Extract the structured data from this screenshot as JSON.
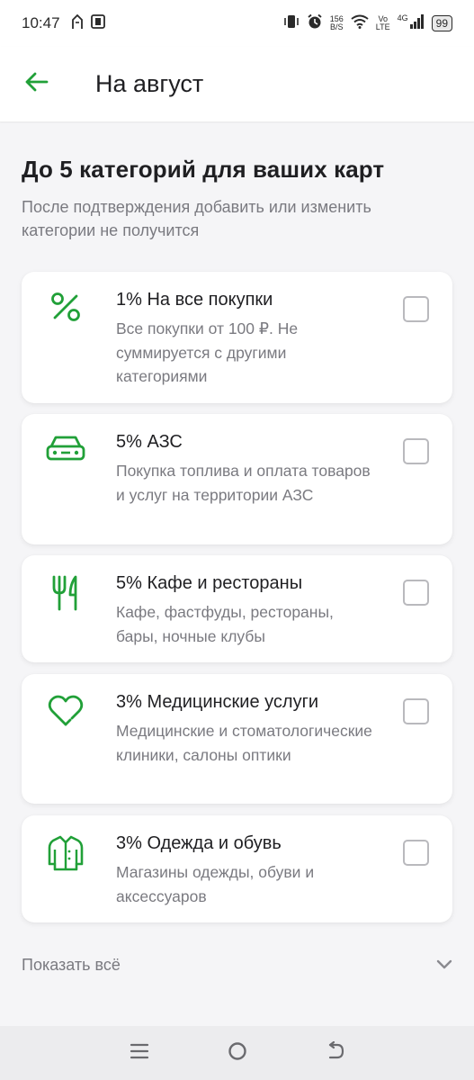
{
  "status_bar": {
    "time": "10:47",
    "network_speed_value": "156",
    "network_speed_unit": "B/S",
    "volte_top": "Vo",
    "volte_bottom": "LTE",
    "network_type": "4G",
    "battery": "99"
  },
  "app_bar": {
    "title": "На август"
  },
  "main": {
    "heading": "До 5 категорий для ваших карт",
    "subheading": "После подтверждения добавить или изменить категории не получится",
    "categories": [
      {
        "title": "1% На все покупки",
        "description": "Все покупки от 100 ₽. Не суммируется с другими категориями",
        "icon": "percent-icon",
        "checked": false
      },
      {
        "title": "5% АЗС",
        "description": "Покупка топлива и оплата товаров и услуг на территории АЗС",
        "icon": "car-icon",
        "checked": false
      },
      {
        "title": "5% Кафе и рестораны",
        "description": "Кафе, фастфуды, рестораны, бары, ночные клубы",
        "icon": "fork-knife-icon",
        "checked": false
      },
      {
        "title": "3% Медицинские услуги",
        "description": "Медицинские и стоматологические клиники, салоны оптики",
        "icon": "heart-icon",
        "checked": false
      },
      {
        "title": "3% Одежда и обувь",
        "description": "Магазины одежды, обуви и аксессуаров",
        "icon": "coat-icon",
        "checked": false
      }
    ],
    "show_all_label": "Показать всё"
  },
  "colors": {
    "accent": "#21a038",
    "text_primary": "#1f1f22",
    "text_secondary": "#7a7a80",
    "background": "#f5f5f7",
    "checkbox_border": "#b9b9bd"
  }
}
